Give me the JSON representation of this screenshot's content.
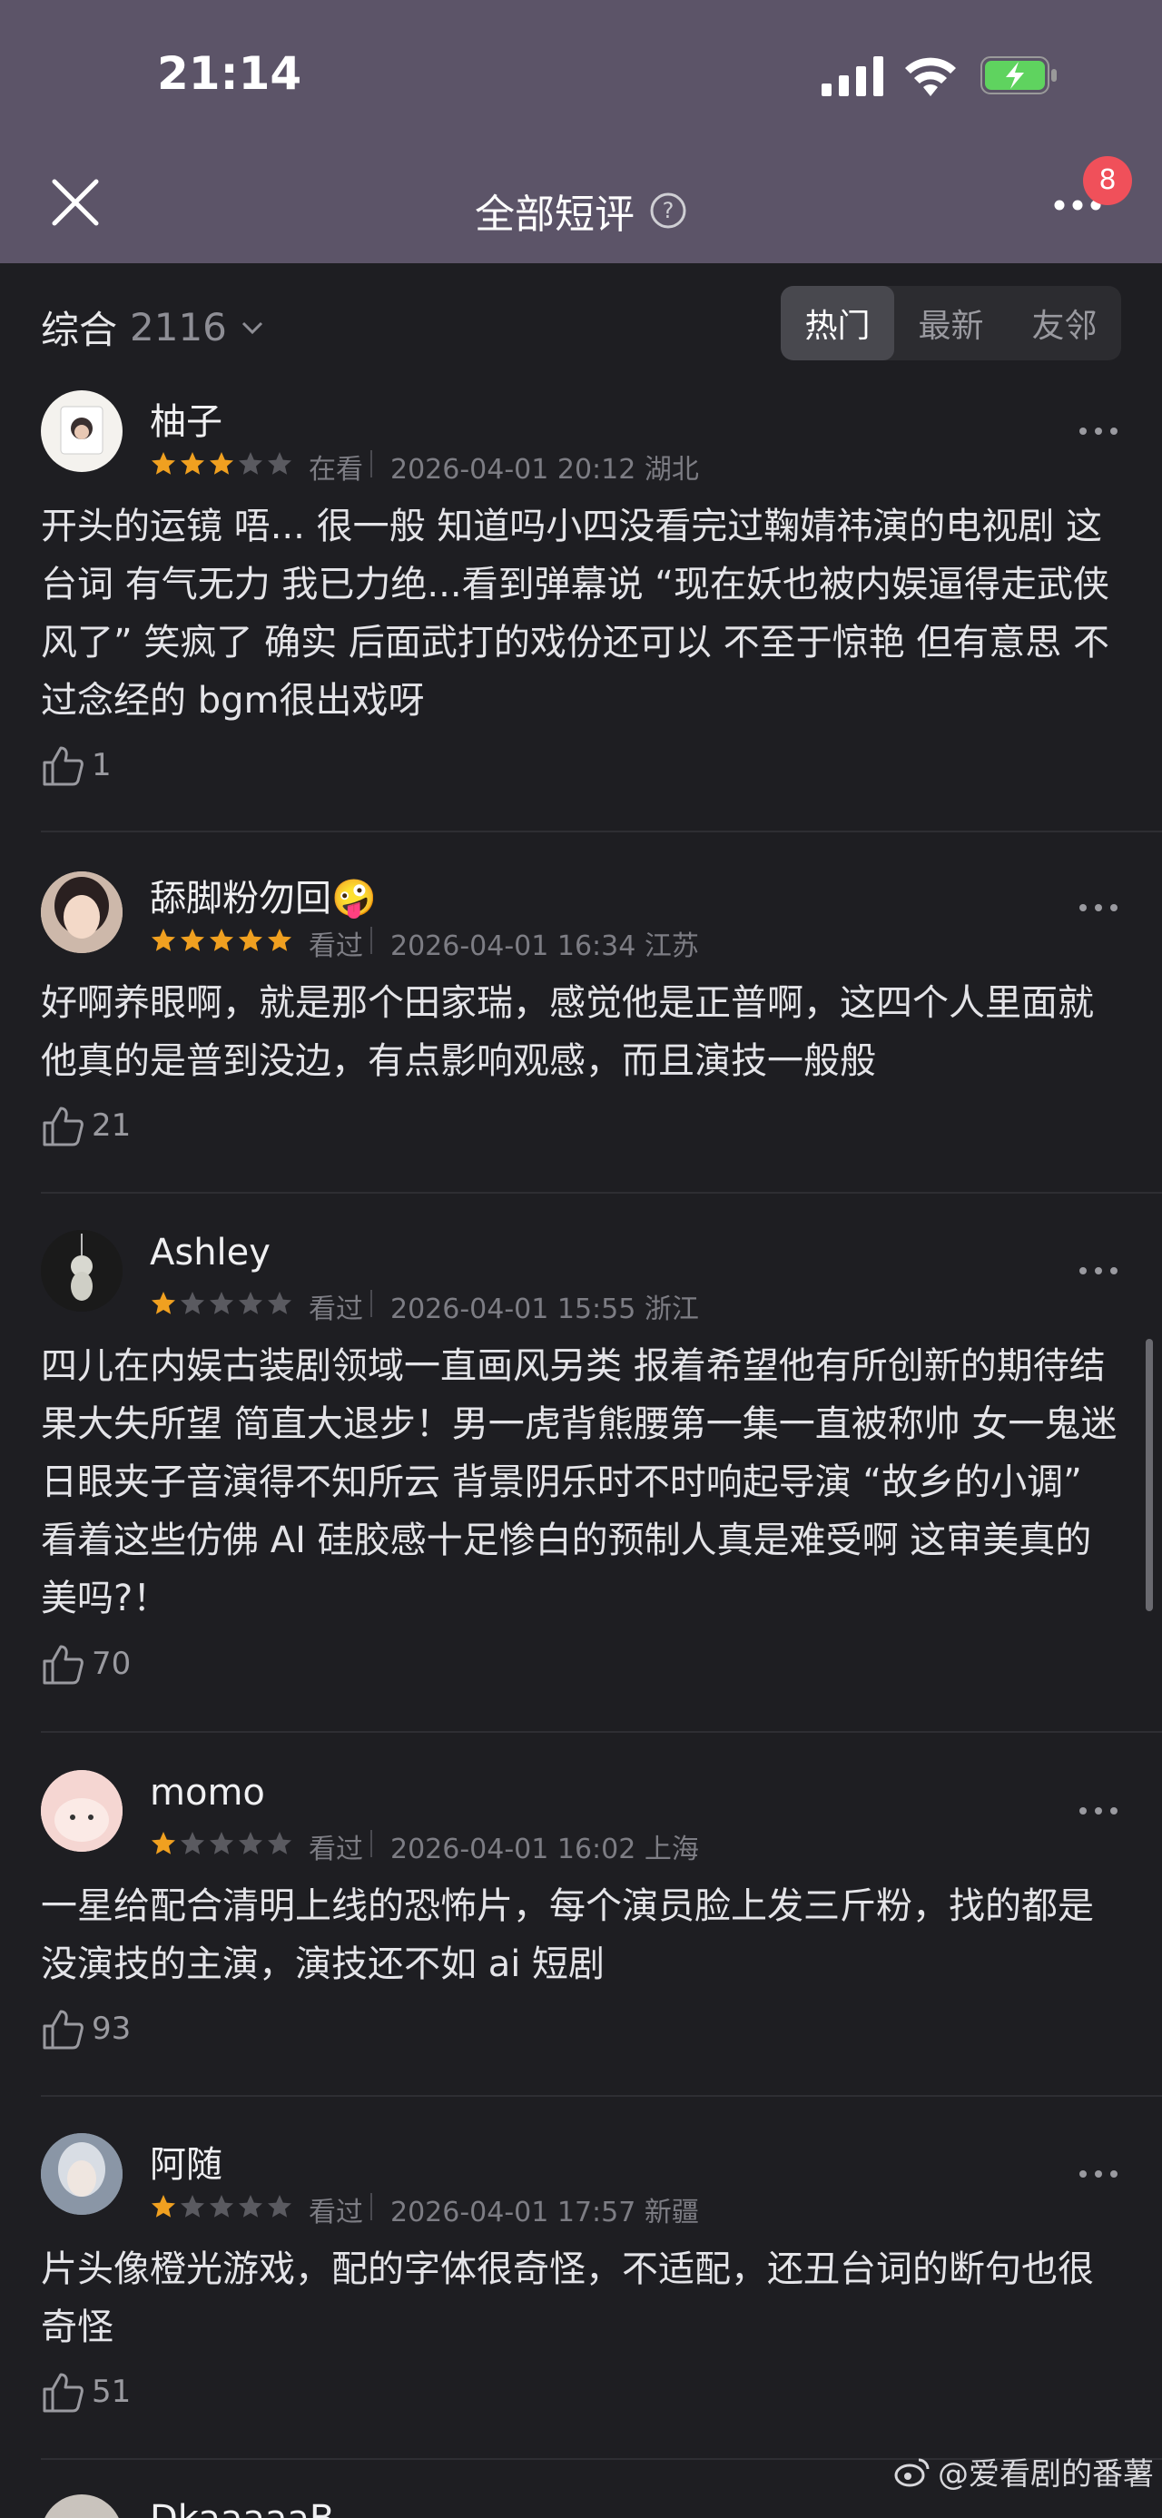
{
  "status_bar": {
    "time": "21:14"
  },
  "header": {
    "title": "全部短评",
    "badge_count": "8"
  },
  "filter": {
    "sort_label": "综合",
    "total_count": "2116",
    "tabs": [
      {
        "label": "热门",
        "active": true
      },
      {
        "label": "最新",
        "active": false
      },
      {
        "label": "友邻",
        "active": false
      }
    ]
  },
  "reviews": [
    {
      "username": "柚子",
      "rating": 3,
      "status": "在看",
      "time_location": "2026-04-01 20:12 湖北",
      "content": "开头的运镜 唔... 很一般 知道吗小四没看完过鞠婧祎演的电视剧 这台词 有气无力 我已力绝...看到弹幕说 “现在妖也被内娱逼得走武侠风了” 笑疯了 确实 后面武打的戏份还可以 不至于惊艳 但有意思 不过念经的 bgm很出戏呀",
      "likes": "1"
    },
    {
      "username": "舔脚粉勿回🤪",
      "rating": 5,
      "status": "看过",
      "time_location": "2026-04-01 16:34 江苏",
      "content": "好啊养眼啊，就是那个田家瑞，感觉他是正普啊，这四个人里面就他真的是普到没边，有点影响观感，而且演技一般般",
      "likes": "21"
    },
    {
      "username": "Ashley",
      "rating": 1,
      "status": "看过",
      "time_location": "2026-04-01 15:55 浙江",
      "content": "四儿在内娱古装剧领域一直画风另类 报着希望他有所创新的期待结果大失所望 简直大退步！男一虎背熊腰第一集一直被称帅 女一鬼迷日眼夹子音演得不知所云 背景阴乐时不时响起导演 “故乡的小调” 看着这些仿佛 AI 硅胶感十足惨白的预制人真是难受啊 这审美真的美吗?！",
      "likes": "70"
    },
    {
      "username": "momo",
      "rating": 1,
      "status": "看过",
      "time_location": "2026-04-01 16:02 上海",
      "content": "一星给配合清明上线的恐怖片，每个演员脸上发三斤粉，找的都是没演技的主演，演技还不如 ai 短剧",
      "likes": "93"
    },
    {
      "username": "阿随",
      "rating": 1,
      "status": "看过",
      "time_location": "2026-04-01 17:57 新疆",
      "content": "片头像橙光游戏，配的字体很奇怪，不适配，还丑台词的断句也很奇怪",
      "likes": "51"
    },
    {
      "username": "DkaaaaaB",
      "rating": 0,
      "status": "",
      "time_location": "",
      "content": "",
      "likes": ""
    }
  ],
  "watermark": "@爱看剧的番薯",
  "colors": {
    "star_on": "#f0a020",
    "star_off": "#5a5a60",
    "header_bg": "#5c5468",
    "page_bg": "#1e1e22"
  }
}
